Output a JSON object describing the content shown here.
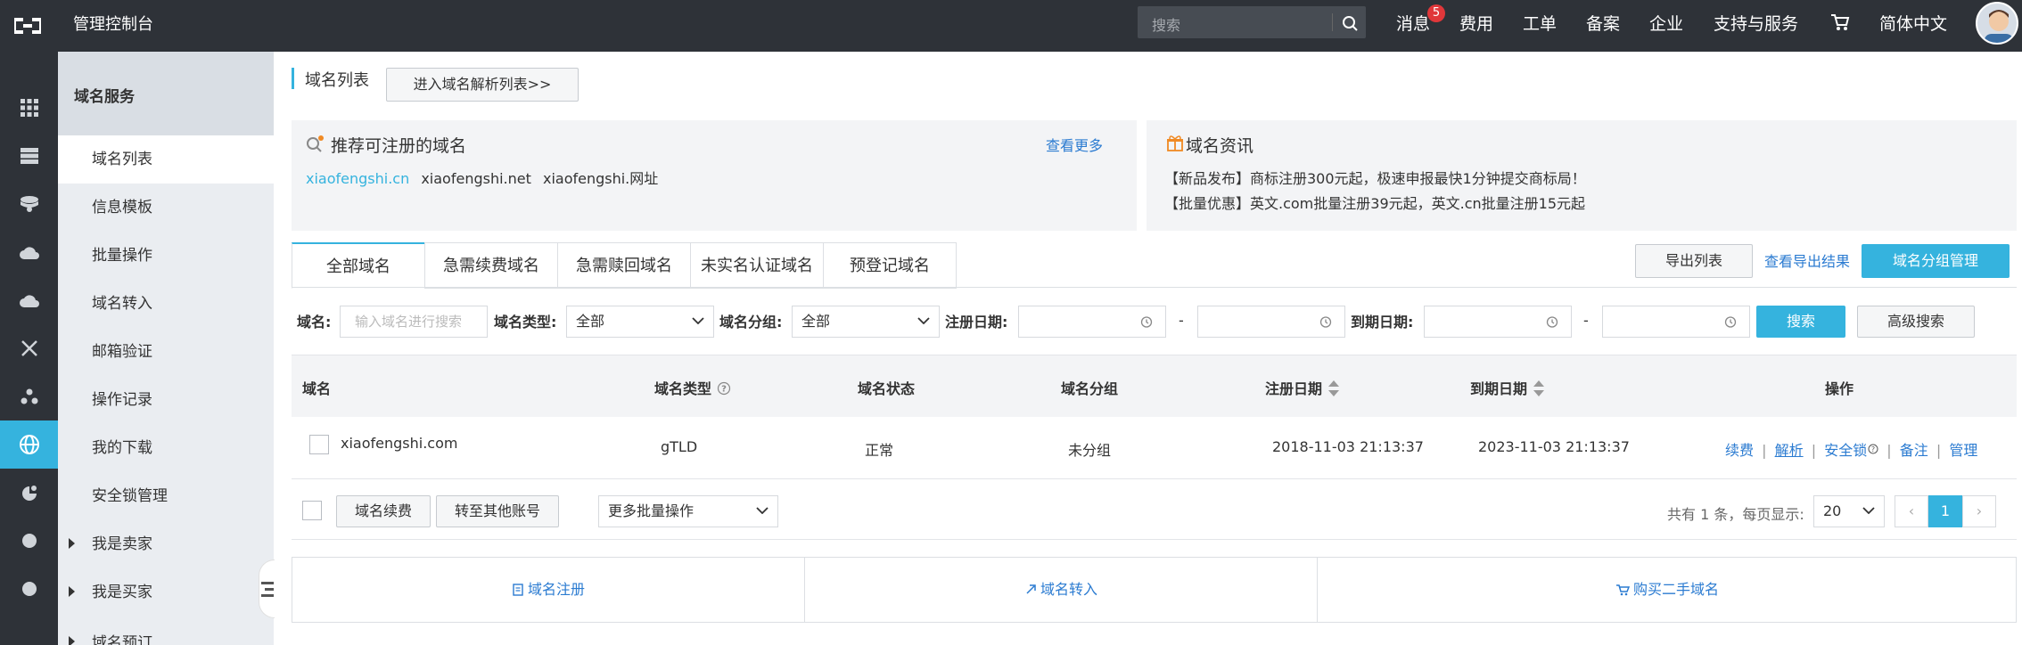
{
  "header": {
    "app_title": "管理控制台",
    "search_placeholder": "搜索",
    "nav": [
      "消息",
      "费用",
      "工单",
      "备案",
      "企业",
      "支持与服务",
      "简体中文"
    ],
    "message_badge": "5"
  },
  "sidebar": {
    "section_title": "域名服务",
    "items": [
      {
        "label": "域名列表",
        "active": true
      },
      {
        "label": "信息模板"
      },
      {
        "label": "批量操作"
      },
      {
        "label": "域名转入"
      },
      {
        "label": "邮箱验证"
      },
      {
        "label": "操作记录"
      },
      {
        "label": "我的下载"
      },
      {
        "label": "安全锁管理"
      },
      {
        "label": "我是卖家",
        "expandable": true
      },
      {
        "label": "我是买家",
        "expandable": true
      },
      {
        "label": "域名预订",
        "expandable": true
      }
    ]
  },
  "page": {
    "title": "域名列表",
    "dns_button": "进入域名解析列表>>"
  },
  "recommend": {
    "title": "推荐可注册的域名",
    "more": "查看更多",
    "domains": [
      "xiaofengshi.cn",
      "xiaofengshi.net",
      "xiaofengshi.网址"
    ]
  },
  "news": {
    "title": "域名资讯",
    "lines": [
      "【新品发布】商标注册300元起，极速申报最快1分钟提交商标局！",
      "【批量优惠】英文.com批量注册39元起，英文.cn批量注册15元起"
    ]
  },
  "tabs": [
    "全部域名",
    "急需续费域名",
    "急需赎回域名",
    "未实名认证域名",
    "预登记域名"
  ],
  "actions": {
    "export": "导出列表",
    "view_export": "查看导出结果",
    "group_manage": "域名分组管理"
  },
  "filters": {
    "domain_label": "域名:",
    "domain_placeholder": "输入域名进行搜索",
    "type_label": "域名类型:",
    "type_value": "全部",
    "group_label": "域名分组:",
    "group_value": "全部",
    "reg_label": "注册日期:",
    "exp_label": "到期日期:",
    "dash": "-",
    "search": "搜索",
    "advanced": "高级搜索"
  },
  "table": {
    "headers": [
      "域名",
      "域名类型",
      "域名状态",
      "域名分组",
      "注册日期",
      "到期日期",
      "操作"
    ],
    "rows": [
      {
        "domain": "xiaofengshi.com",
        "type": "gTLD",
        "status": "正常",
        "group": "未分组",
        "reg": "2018-11-03 21:13:37",
        "exp": "2023-11-03 21:13:37",
        "ops": [
          "续费",
          "解析",
          "安全锁",
          "备注",
          "管理"
        ]
      }
    ],
    "sep": "|"
  },
  "footer": {
    "renew": "域名续费",
    "transfer_account": "转至其他账号",
    "more_batch": "更多批量操作",
    "summary": "共有 1 条，每页显示:",
    "page_size": "20",
    "prev": "‹",
    "page": "1",
    "next": "›"
  },
  "bottom": {
    "register": "域名注册",
    "transfer_in": "域名转入",
    "buy_second": "购买二手域名"
  },
  "colors": {
    "accent": "#35b3de",
    "link": "#2b7bd1",
    "topbar": "#2e3238"
  }
}
